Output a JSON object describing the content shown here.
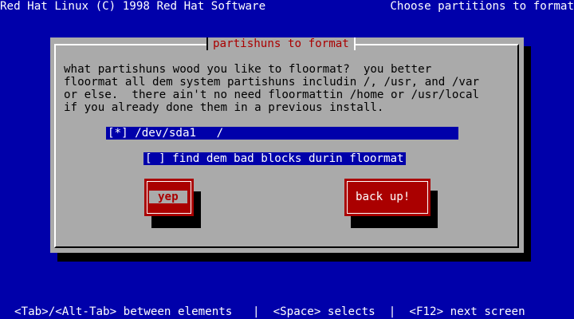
{
  "header": {
    "left_title": "Red Hat Linux (C) 1998 Red Hat Software",
    "right_title": "Choose partitions to format"
  },
  "dialog": {
    "title": "partishuns to format",
    "message": [
      "what partishuns wood you like to floormat?  you better",
      "floormat all dem system partishuns includin /, /usr, and /var",
      "or else.  there ain't no need floormattin /home or /usr/local",
      "if you already done them in a previous install."
    ],
    "partitions": [
      {
        "label": "[*] /dev/sda1   /",
        "selected": true
      }
    ],
    "checkbox_label": "[ ] find dem bad blocks durin floormat",
    "buttons": {
      "ok_label": "yep",
      "back_label": "back up!"
    }
  },
  "footer": {
    "help_text": "<Tab>/<Alt-Tab> between elements   |  <Space> selects  |  <F12> next screen"
  },
  "colors": {
    "background": "#0000aa",
    "dialog": "#aaaaaa",
    "accent": "#aa0000",
    "text": "#000000",
    "highlight_text": "#ffffff"
  }
}
